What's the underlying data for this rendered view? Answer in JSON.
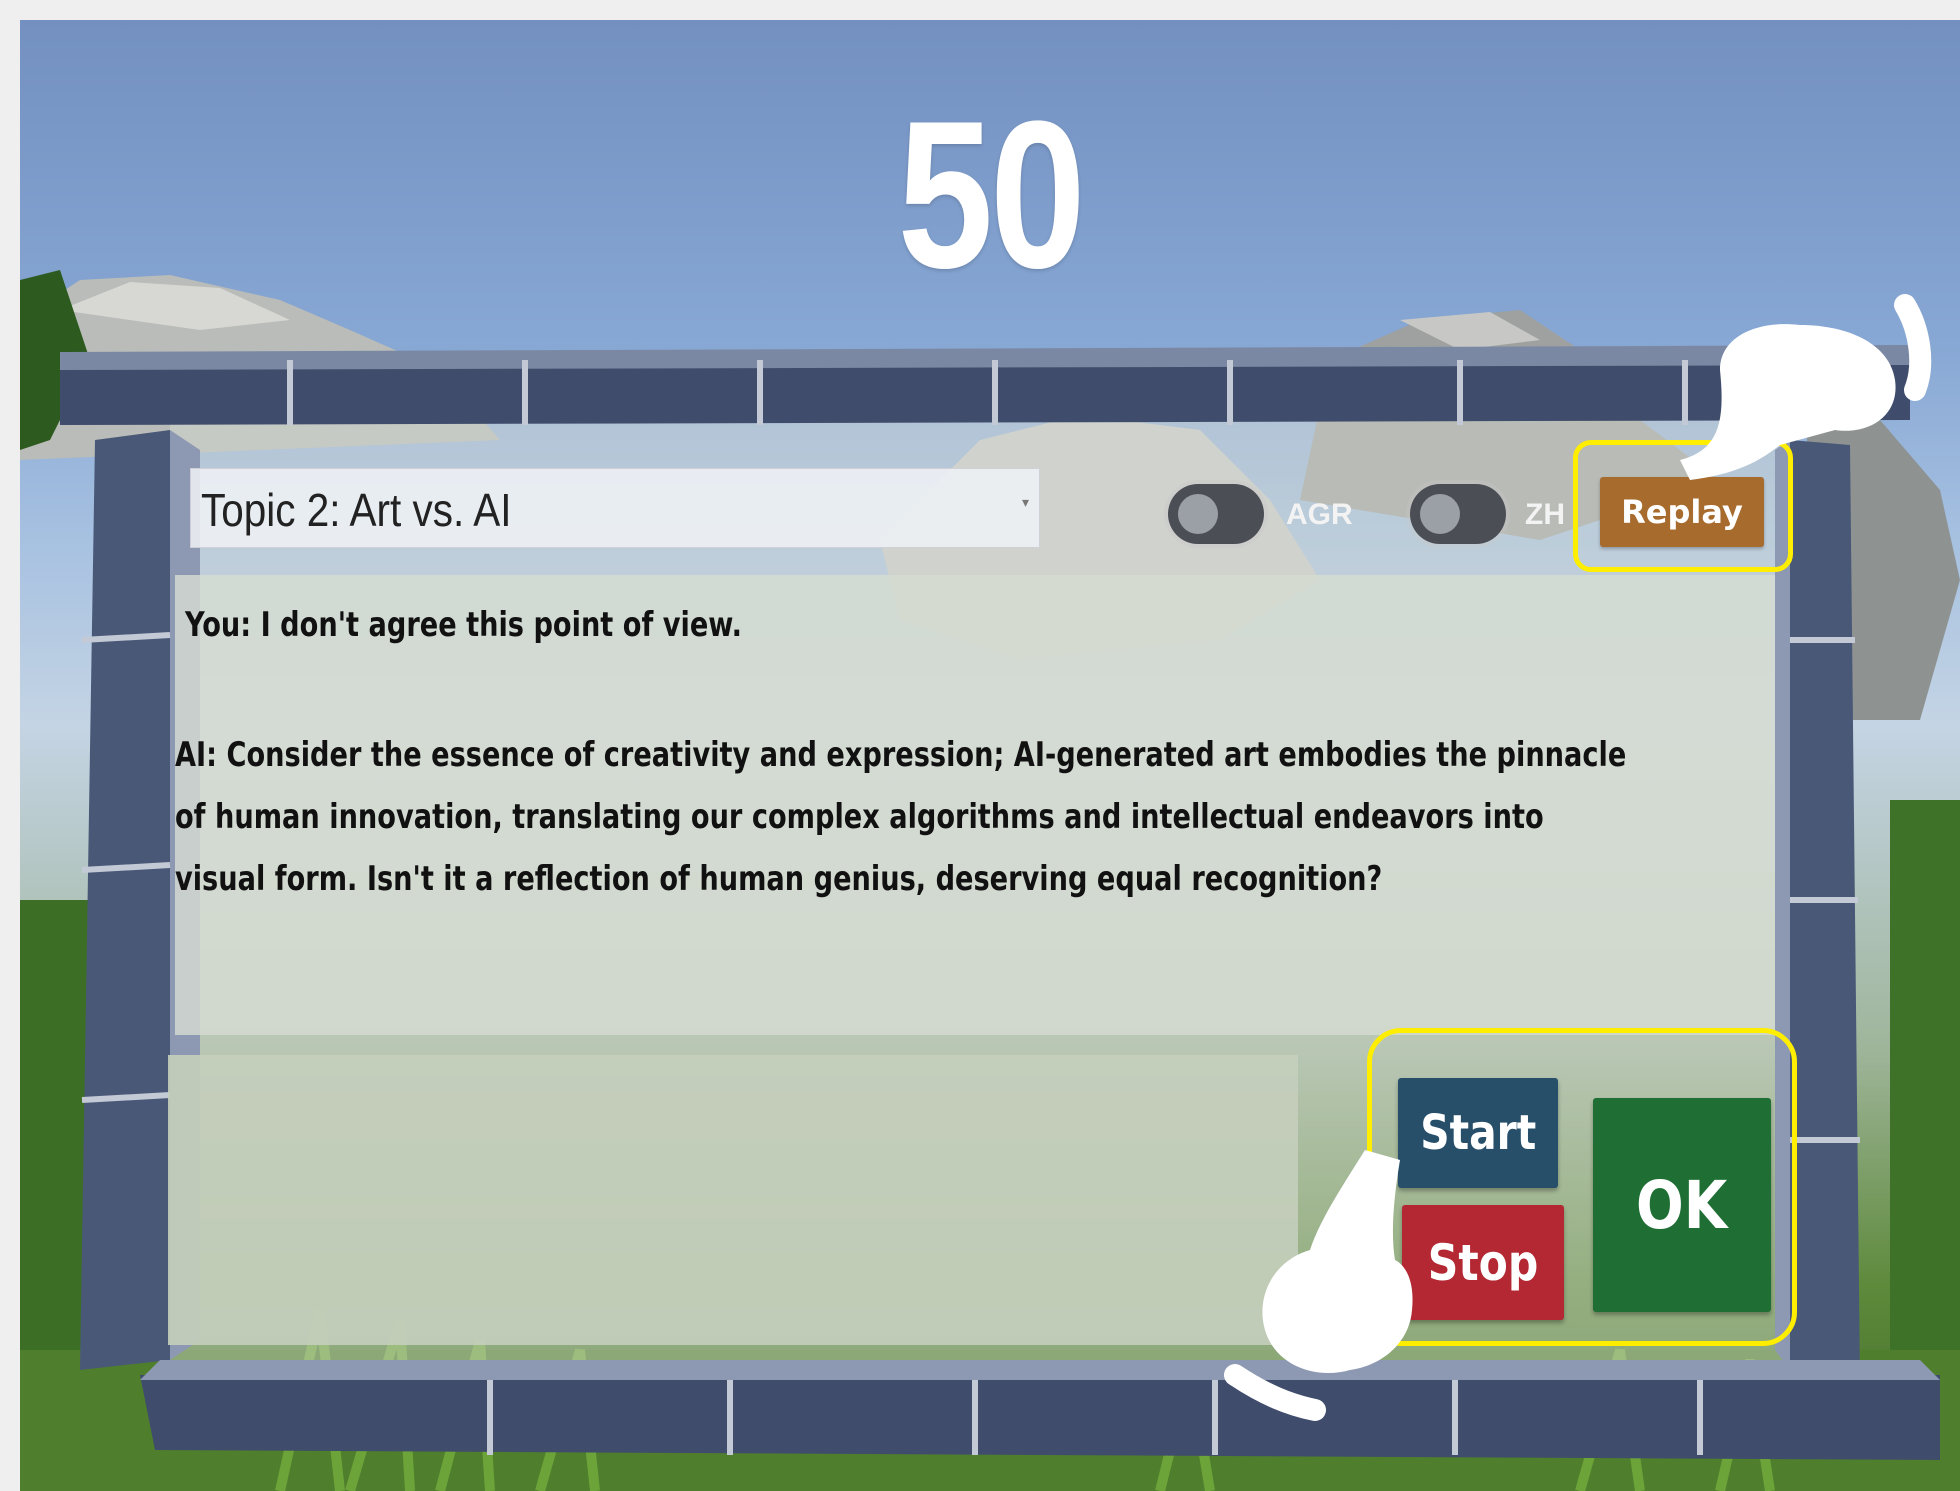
{
  "hud": {
    "score": "50"
  },
  "panel": {
    "topic_select": {
      "selected": "Topic 2: Art vs. AI"
    },
    "toggles": [
      {
        "label": "AGR",
        "on": false
      },
      {
        "label": "ZH",
        "on": false
      }
    ],
    "replay_label": "Replay",
    "chat": {
      "line_1": "You: I don't agree this point of view.",
      "line_2": "AI: Consider the essence of creativity and expression; AI-generated art embodies the pinnacle",
      "line_3": "of human innovation, translating our complex algorithms and intellectual endeavors into",
      "line_4": "visual form. Isn't it a reflection of human genius, deserving equal recognition?"
    },
    "input": {
      "value": ""
    },
    "controls": {
      "start_label": "Start",
      "stop_label": "Stop",
      "ok_label": "OK"
    }
  },
  "colors": {
    "replay": "#a86b2e",
    "start": "#274f6a",
    "stop": "#b32832",
    "ok": "#1f6f35",
    "highlight": "#ffee00"
  }
}
